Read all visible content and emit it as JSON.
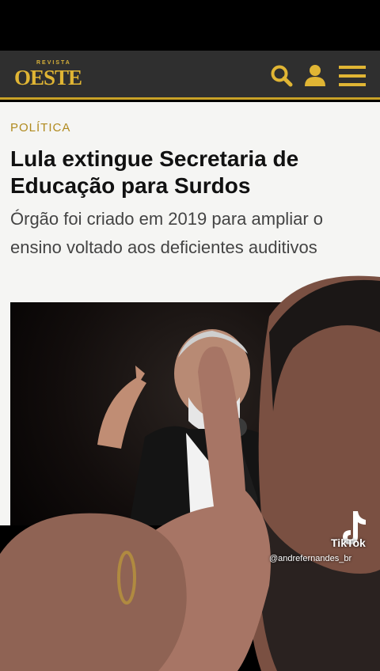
{
  "header": {
    "logo_small": "REVISTA",
    "logo_big": "OESTE",
    "accent": "#c9a227",
    "icons": [
      "search-icon",
      "user-icon",
      "menu-icon"
    ]
  },
  "article": {
    "kicker": "POLÍTICA",
    "headline": "Lula extingue Secretaria de Educação para Surdos",
    "subhead": "Órgão foi criado em 2019 para ampliar o ensino voltado aos deficientes auditivos"
  },
  "watermark": {
    "label": "TikTok",
    "handle": "@andrefernandes_br"
  }
}
